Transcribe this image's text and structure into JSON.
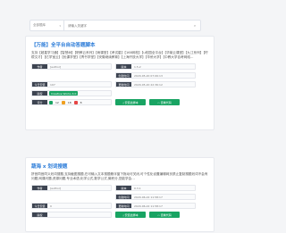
{
  "search": {
    "scope": "全部题库",
    "placeholder": "请输入关键字"
  },
  "cards": [
    {
      "title": "【万能】全平台自动答题脚本",
      "desc": "支持【超星学习通】【智慧树】【职教云系列】【雨课堂】【考试星】【168网校】【u校园全平台】【华莱云课堂】【九江系列】【柠檬文才】【亿学宝云】【优课学堂】【青书学堂】【安徽继续教育】【上海开放大学】【华侨大学】【中教大学自考网络…",
      "author_label": "作者",
      "author": "[author]",
      "version_label": "版本",
      "version": "1.5.2",
      "created_label": "创建时间",
      "created": "2020-05-20 07:06:13",
      "count_label": "今日安装",
      "count": "107",
      "updated_label": "更新时间",
      "updated": "2020-05-20 22:36:12",
      "license_label": "版权",
      "license": "Creative Works 4.0",
      "stat_a": "12",
      "stat_b": "18",
      "stat_c": "8",
      "install_btn": "安装此脚本",
      "view_btn": "查看代码"
    },
    {
      "title": "蔬海 x 划词搜题",
      "desc": "拼音同音同义划词搜题,支持截图搜题,在可输入文本搜题悬浮窗下拖动可关闭,可个性化设置编辑网页禁止复制搜题划词不会有问题,网课问题,资源问题,专业术语,化学公式,数学公式,微积分,您能学会…",
      "author_label": "作者",
      "author": "[author]",
      "version_label": "版本",
      "version": "0.3.1",
      "created_label": "创建时间",
      "created": "2020-06-22 11:58:17",
      "count_label": "今日安装",
      "count": "0",
      "updated_label": "更新时间",
      "updated": "2020-06-22 11:58:17",
      "license_label": "版权",
      "license": "",
      "install_btn": "安装此脚本",
      "view_btn": "查看代码"
    }
  ],
  "colors": {
    "accent": "#2a7bd8",
    "green": "#19a463",
    "label_bg": "#3d4451",
    "red": "#e64545",
    "orange": "#f0a020"
  }
}
